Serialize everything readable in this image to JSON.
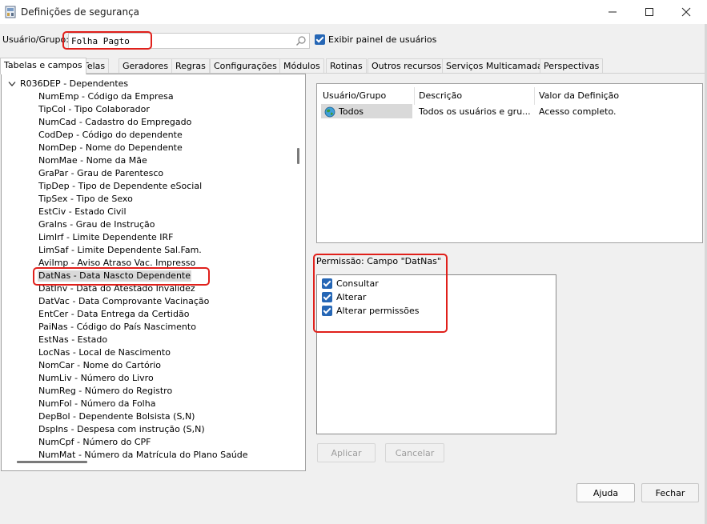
{
  "window": {
    "title": "Definições de segurança"
  },
  "user_group": {
    "label": "Usuário/Grupo:",
    "value": "Folha Pagto",
    "show_panel_label": "Exibir painel de usuários"
  },
  "tabs": [
    "Tabelas e campos",
    "Telas",
    "Geradores",
    "Regras",
    "Configurações",
    "Módulos",
    "Rotinas",
    "Outros recursos",
    "Serviços Multicamada",
    "Perspectivas"
  ],
  "tree": {
    "root": "R036DEP - Dependentes",
    "items": [
      "NumEmp - Código da Empresa",
      "TipCol - Tipo Colaborador",
      "NumCad - Cadastro do Empregado",
      "CodDep - Código do dependente",
      "NomDep - Nome do Dependente",
      "NomMae - Nome da Mãe",
      "GraPar - Grau de Parentesco",
      "TipDep - Tipo de Dependente eSocial",
      "TipSex - Tipo de Sexo",
      "EstCiv - Estado Civil",
      "GraIns - Grau de Instrução",
      "LimIrf - Limite Dependente IRF",
      "LimSaf - Limite Dependente Sal.Fam.",
      "AviImp - Aviso Atraso Vac. Impresso",
      "DatNas - Data Nascto Dependente",
      "DatInv - Data do Atestado Invalidez",
      "DatVac - Data Comprovante Vacinação",
      "EntCer - Data Entrega da Certidão",
      "PaiNas - Código do País Nascimento",
      "EstNas - Estado",
      "LocNas - Local de Nascimento",
      "NomCar - Nome do Cartório",
      "NumLiv - Número do Livro",
      "NumReg - Número do Registro",
      "NumFol - Número da Folha",
      "DepBol - Dependente Bolsista (S,N)",
      "DspIns - Despesa com instrução (S,N)",
      "NumCpf - Número do CPF",
      "NumMat - Número da Matrícula do Plano Saúde"
    ],
    "selected_index": 14
  },
  "grid": {
    "headers": [
      "Usuário/Grupo",
      "Descrição",
      "Valor da Definição"
    ],
    "row": {
      "user": "Todos",
      "description": "Todos os usuários e gru...",
      "value": "Acesso completo."
    }
  },
  "permission": {
    "title": "Permissão: Campo \"DatNas\"",
    "items": [
      {
        "label": "Consultar",
        "checked": true
      },
      {
        "label": "Alterar",
        "checked": true
      },
      {
        "label": "Alterar permissões",
        "checked": true
      }
    ]
  },
  "buttons": {
    "apply": "Aplicar",
    "cancel": "Cancelar",
    "help": "Ajuda",
    "close": "Fechar"
  },
  "colors": {
    "accent": "#2566b5",
    "highlight": "#e0201b",
    "selection": "#d9d9d9"
  }
}
